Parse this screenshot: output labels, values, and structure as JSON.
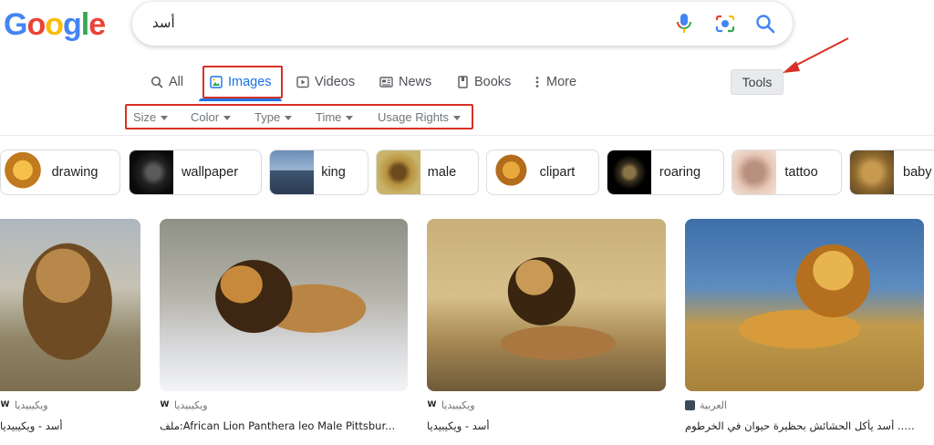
{
  "logo": {
    "letters": [
      "G",
      "o",
      "o",
      "g",
      "l",
      "e"
    ],
    "colors": [
      "#4285f4",
      "#ea4335",
      "#fbbc05",
      "#4285f4",
      "#34a853",
      "#ea4335"
    ]
  },
  "search": {
    "query": "أسد",
    "icons": [
      "mic-icon",
      "camera-lens-icon",
      "search-icon"
    ]
  },
  "tabs": [
    {
      "label": "All",
      "icon": "search-icon"
    },
    {
      "label": "Images",
      "icon": "image-icon",
      "active": true
    },
    {
      "label": "Videos",
      "icon": "play-icon"
    },
    {
      "label": "News",
      "icon": "newspaper-icon"
    },
    {
      "label": "Books",
      "icon": "book-icon"
    },
    {
      "label": "More",
      "icon": "more-vertical-icon"
    }
  ],
  "tools_label": "Tools",
  "filters": [
    "Size",
    "Color",
    "Type",
    "Time",
    "Usage Rights"
  ],
  "chips": [
    {
      "label": "drawing"
    },
    {
      "label": "wallpaper"
    },
    {
      "label": "king"
    },
    {
      "label": "male"
    },
    {
      "label": "clipart"
    },
    {
      "label": "roaring"
    },
    {
      "label": "tattoo"
    },
    {
      "label": "baby"
    }
  ],
  "results": [
    {
      "source": "ويكيبيديا",
      "favicon": "W",
      "caption": "أسد - ويكيبيديا"
    },
    {
      "source": "ويكيبيديا",
      "favicon": "W",
      "caption": "ملف:African Lion Panthera leo Male Pittsbur..."
    },
    {
      "source": "ويكيبيديا",
      "favicon": "W",
      "caption": "أسد - ويكيبيديا"
    },
    {
      "source": "العربية",
      "favicon": "",
      "caption": "فيديو عجيب.. أسد يأكل الحشائش بحظيرة حيوان في الخرطوم"
    }
  ],
  "colors": {
    "accent": "#1a73e8",
    "annotation": "#d93025"
  }
}
